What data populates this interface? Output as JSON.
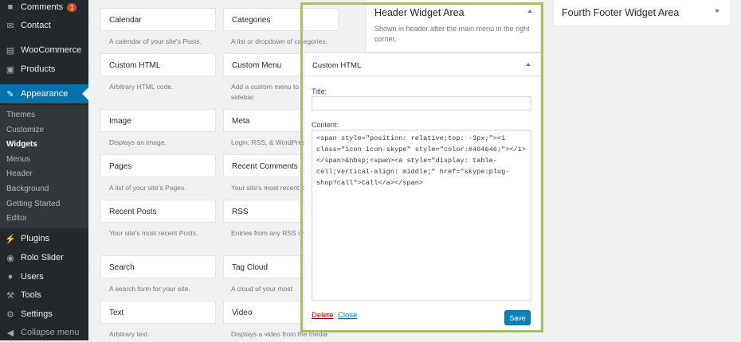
{
  "sidebar": {
    "items": [
      {
        "label": "Comments",
        "icon": "comment-icon",
        "badge": "1"
      },
      {
        "label": "Contact",
        "icon": "mail-icon"
      },
      {
        "label": "WooCommerce",
        "icon": "woocommerce-icon"
      },
      {
        "label": "Products",
        "icon": "products-icon"
      },
      {
        "label": "Appearance",
        "icon": "paintbrush-icon"
      },
      {
        "label": "Plugins",
        "icon": "plugin-icon"
      },
      {
        "label": "Rolo Slider",
        "icon": "slider-icon"
      },
      {
        "label": "Users",
        "icon": "users-icon"
      },
      {
        "label": "Tools",
        "icon": "wrench-icon"
      },
      {
        "label": "Settings",
        "icon": "settings-icon"
      },
      {
        "label": "Collapse menu",
        "icon": "collapse-icon"
      }
    ],
    "submenu": [
      "Themes",
      "Customize",
      "Widgets",
      "Menus",
      "Header",
      "Background",
      "Getting Started",
      "Editor"
    ]
  },
  "widgets": [
    {
      "name": "Calendar",
      "desc": "A calendar of your site's Posts."
    },
    {
      "name": "Categories",
      "desc": "A list or dropdown of categories."
    },
    {
      "name": "Custom HTML",
      "desc": "Arbitrary HTML code."
    },
    {
      "name": "Custom Menu",
      "desc": "Add a custom menu to sidebar."
    },
    {
      "name": "Image",
      "desc": "Displays an image."
    },
    {
      "name": "Meta",
      "desc": "Login, RSS, & WordPress."
    },
    {
      "name": "Pages",
      "desc": "A list of your site's Pages."
    },
    {
      "name": "Recent Comments",
      "desc": "Your site's most recent c"
    },
    {
      "name": "Recent Posts",
      "desc": "Your site's most recent Posts."
    },
    {
      "name": "RSS",
      "desc": "Entries from any RSS or A"
    },
    {
      "name": "Search",
      "desc": "A search form for your site."
    },
    {
      "name": "Tag Cloud",
      "desc": "A cloud of your most"
    },
    {
      "name": "Text",
      "desc": "Arbitrary text."
    },
    {
      "name": "Video",
      "desc": "Displays a video from the media"
    }
  ],
  "header_area": {
    "title": "Header Widget Area",
    "desc": "Shown in header after the main menu in the right corner.",
    "widget": {
      "title": "Custom HTML",
      "title_label": "Title:",
      "title_value": "",
      "content_label": "Content:",
      "content_value": "<span style=\"position: relative;top: -3px;\"><i class=\"icon icon-skype\" style=\"color:#464646;\"></i></span>&nbsp;<span><a style=\"display: table-cell;vertical-align: middle;\" href=\"skype:plug-shop?call\">Call</a></span>",
      "delete_label": "Delete",
      "separator": "|",
      "close_label": "Close",
      "save_label": "Save"
    }
  },
  "footer_area": {
    "title": "Fourth Footer Widget Area"
  },
  "colors": {
    "accent": "#0073aa",
    "highlight": "#a5c93c",
    "sidebar": "#23282d",
    "save": "#0085ba",
    "badge": "#d54e21",
    "delete": "#a00"
  }
}
